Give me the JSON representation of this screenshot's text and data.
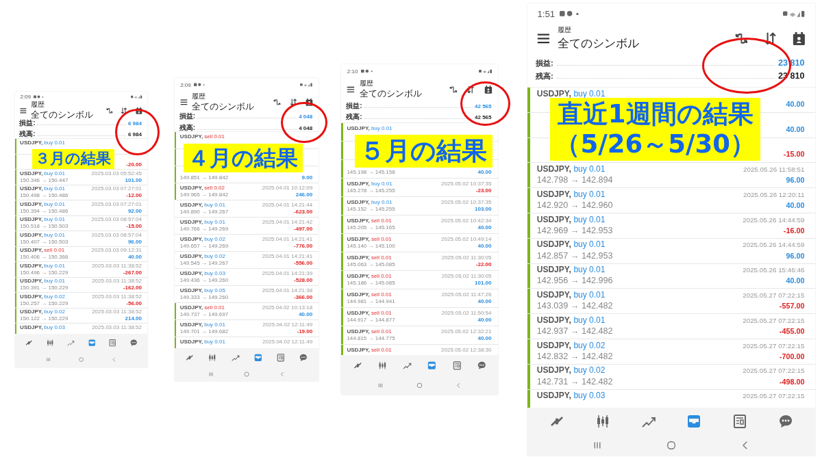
{
  "phones": [
    {
      "status_time": "2:09",
      "subtitle": "履歴",
      "title": "全てのシンボル",
      "summary": [
        {
          "label": "損益:",
          "value": "6 984",
          "kind": "profit"
        },
        {
          "label": "残高:",
          "value": "6 984",
          "kind": "balance"
        }
      ],
      "rows": [
        {
          "symbol": "USDJPY,",
          "order": "buy 0.01",
          "kind": "buy",
          "flagged": true
        },
        {
          "profit": "-20.00",
          "loss": true,
          "flagged": true
        },
        {
          "symbol": "USDJPY,",
          "order": "buy 0.01",
          "kind": "buy",
          "time": "2025.03.03 05:52:45",
          "prices": "150.346 → 150.447",
          "profit": "101.00",
          "loss": false,
          "flagged": true
        },
        {
          "symbol": "USDJPY,",
          "order": "buy 0.01",
          "kind": "buy",
          "time": "2025.03.03 07:27:01",
          "prices": "150.498 → 150.486",
          "profit": "-12.00",
          "loss": true,
          "flagged": true
        },
        {
          "symbol": "USDJPY,",
          "order": "buy 0.01",
          "kind": "buy",
          "time": "2025.03.03 07:27:01",
          "prices": "150.394 → 150.486",
          "profit": "92.00",
          "loss": false,
          "flagged": true
        },
        {
          "symbol": "USDJPY,",
          "order": "buy 0.01",
          "kind": "buy",
          "time": "2025.03.03 08:57:04",
          "prices": "150.518 → 150.503",
          "profit": "-15.00",
          "loss": true,
          "flagged": true
        },
        {
          "symbol": "USDJPY,",
          "order": "buy 0.01",
          "kind": "buy",
          "time": "2025.03.03 08:57:04",
          "prices": "150.407 → 150.503",
          "profit": "96.00",
          "loss": false,
          "flagged": true
        },
        {
          "symbol": "USDJPY,",
          "order": "sell 0.01",
          "kind": "sell",
          "time": "2025.03.03 09:12:31",
          "prices": "150.406 → 150.366",
          "profit": "40.00",
          "loss": false,
          "flagged": true
        },
        {
          "symbol": "USDJPY,",
          "order": "buy 0.01",
          "kind": "buy",
          "time": "2025.03.03 11:38:52",
          "prices": "150.496 → 150.229",
          "profit": "-267.00",
          "loss": true,
          "flagged": true
        },
        {
          "symbol": "USDJPY,",
          "order": "buy 0.01",
          "kind": "buy",
          "time": "2025.03.03 11:38:52",
          "prices": "150.391 → 150.229",
          "profit": "-162.00",
          "loss": true,
          "flagged": true
        },
        {
          "symbol": "USDJPY,",
          "order": "buy 0.02",
          "kind": "buy",
          "time": "2025.03.03 11:38:52",
          "prices": "150.257 → 150.229",
          "profit": "-56.00",
          "loss": true,
          "flagged": true
        },
        {
          "symbol": "USDJPY,",
          "order": "buy 0.02",
          "kind": "buy",
          "time": "2025.03.03 11:38:52",
          "prices": "150.122 → 150.229",
          "profit": "214.00",
          "loss": false,
          "flagged": true
        },
        {
          "symbol": "USDJPY,",
          "order": "buy 0.03",
          "kind": "buy",
          "time": "2025.03.03 11:38:52",
          "flagged": true
        }
      ],
      "nav": [
        {
          "kind": "quotes",
          "selected": false
        },
        {
          "kind": "chart",
          "selected": false
        },
        {
          "kind": "trade",
          "selected": false
        },
        {
          "kind": "history",
          "selected": true
        },
        {
          "kind": "news",
          "selected": false
        },
        {
          "kind": "chat",
          "selected": false
        }
      ],
      "caption": [
        "３月の結果"
      ]
    },
    {
      "status_time": "2:09",
      "subtitle": "履歴",
      "title": "全てのシンボル",
      "summary": [
        {
          "label": "損益:",
          "value": "4 048",
          "kind": "profit"
        },
        {
          "label": "残高:",
          "value": "4 048",
          "kind": "balance"
        }
      ],
      "rows": [
        {
          "symbol": "USDJPY,",
          "order": "sell 0.01",
          "kind": "sell",
          "flagged": true
        },
        {
          "flagged": true
        },
        {
          "prices": "149.851 → 149.842",
          "profit": "9.00",
          "loss": false,
          "flagged": true
        },
        {
          "symbol": "USDJPY,",
          "order": "sell 0.02",
          "kind": "sell",
          "time": "2025.04.01 10:12:09",
          "prices": "149.965 → 149.842",
          "profit": "246.00",
          "loss": false,
          "flagged": true
        },
        {
          "symbol": "USDJPY,",
          "order": "buy 0.01",
          "kind": "buy",
          "time": "2025.04.01 14:21:44",
          "prices": "149.890 → 149.267",
          "profit": "-623.00",
          "loss": true,
          "flagged": false
        },
        {
          "symbol": "USDJPY,",
          "order": "buy 0.01",
          "kind": "buy",
          "time": "2025.04.01 14:21:42",
          "prices": "149.766 → 149.269",
          "profit": "-497.00",
          "loss": true,
          "flagged": false
        },
        {
          "symbol": "USDJPY,",
          "order": "buy 0.02",
          "kind": "buy",
          "time": "2025.04.01 14:21:41",
          "prices": "149.657 → 149.269",
          "profit": "-776.00",
          "loss": true,
          "flagged": false
        },
        {
          "symbol": "USDJPY,",
          "order": "buy 0.02",
          "kind": "buy",
          "time": "2025.04.01 14:21:41",
          "prices": "149.545 → 149.267",
          "profit": "-556.00",
          "loss": true,
          "flagged": false
        },
        {
          "symbol": "USDJPY,",
          "order": "buy 0.03",
          "kind": "buy",
          "time": "2025.04.01 14:21:39",
          "prices": "149.436 → 149.260",
          "profit": "-528.00",
          "loss": true,
          "flagged": false
        },
        {
          "symbol": "USDJPY,",
          "order": "buy 0.05",
          "kind": "buy",
          "time": "2025.04.01 14:21:38",
          "prices": "149.333 → 149.260",
          "profit": "-366.00",
          "loss": true,
          "flagged": false
        },
        {
          "symbol": "USDJPY,",
          "order": "sell 0.01",
          "kind": "sell",
          "time": "2025.04.02 10:13:18",
          "prices": "149.737 → 149.697",
          "profit": "40.00",
          "loss": false,
          "flagged": true
        },
        {
          "symbol": "USDJPY,",
          "order": "buy 0.01",
          "kind": "buy",
          "time": "2025.04.02 12:11:49",
          "prices": "149.701 → 149.682",
          "profit": "-19.00",
          "loss": true,
          "flagged": true
        },
        {
          "symbol": "USDJPY,",
          "order": "buy 0.01",
          "kind": "buy",
          "time": "2025.04.02 12:11:49",
          "flagged": true
        }
      ],
      "nav": [
        {
          "kind": "quotes",
          "selected": false
        },
        {
          "kind": "chart",
          "selected": false
        },
        {
          "kind": "trade",
          "selected": false
        },
        {
          "kind": "history",
          "selected": true
        },
        {
          "kind": "news",
          "selected": false
        },
        {
          "kind": "chat",
          "selected": false
        }
      ],
      "caption": [
        "４月の結果"
      ]
    },
    {
      "status_time": "2:10",
      "subtitle": "履歴",
      "title": "全てのシンボル",
      "summary": [
        {
          "label": "損益:",
          "value": "42 565",
          "kind": "profit"
        },
        {
          "label": "残高:",
          "value": "42 565",
          "kind": "balance"
        }
      ],
      "rows": [
        {
          "symbol": "USDJPY,",
          "order": "buy 0.01",
          "kind": "buy",
          "flagged": true
        },
        {
          "flagged": true
        },
        {
          "prices": "145.198 → 145.158",
          "profit": "40.00",
          "loss": false,
          "flagged": true
        },
        {
          "symbol": "USDJPY,",
          "order": "buy 0.01",
          "kind": "buy",
          "time": "2025.05.02 10:37:35",
          "prices": "145.278 → 145.255",
          "profit": "-23.00",
          "loss": true,
          "flagged": true
        },
        {
          "symbol": "USDJPY,",
          "order": "buy 0.01",
          "kind": "buy",
          "time": "2025.05.02 10:37:35",
          "prices": "145.152 → 145.255",
          "profit": "103.00",
          "loss": false,
          "flagged": true
        },
        {
          "symbol": "USDJPY,",
          "order": "sell 0.01",
          "kind": "sell",
          "time": "2025.05.02 10:42:34",
          "prices": "145.205 → 145.165",
          "profit": "40.00",
          "loss": false,
          "flagged": true
        },
        {
          "symbol": "USDJPY,",
          "order": "sell 0.01",
          "kind": "sell",
          "time": "2025.05.02 10:49:14",
          "prices": "145.140 → 145.100",
          "profit": "40.00",
          "loss": false,
          "flagged": true
        },
        {
          "symbol": "USDJPY,",
          "order": "sell 0.01",
          "kind": "sell",
          "time": "2025.05.02 11:30:05",
          "prices": "145.063 → 145.085",
          "profit": "-22.00",
          "loss": true,
          "flagged": true
        },
        {
          "symbol": "USDJPY,",
          "order": "sell 0.01",
          "kind": "sell",
          "time": "2025.05.02 11:30:05",
          "prices": "145.186 → 145.085",
          "profit": "101.00",
          "loss": false,
          "flagged": true
        },
        {
          "symbol": "USDJPY,",
          "order": "sell 0.01",
          "kind": "sell",
          "time": "2025.05.02 11:47:26",
          "prices": "144.981 → 144.941",
          "profit": "40.00",
          "loss": false,
          "flagged": true
        },
        {
          "symbol": "USDJPY,",
          "order": "sell 0.01",
          "kind": "sell",
          "time": "2025.05.02 11:50:54",
          "prices": "144.917 → 144.877",
          "profit": "40.00",
          "loss": false,
          "flagged": true
        },
        {
          "symbol": "USDJPY,",
          "order": "sell 0.01",
          "kind": "sell",
          "time": "2025.05.02 12:32:21",
          "prices": "144.815 → 144.775",
          "profit": "40.00",
          "loss": false,
          "flagged": true
        },
        {
          "symbol": "USDJPY,",
          "order": "sell 0.01",
          "kind": "sell",
          "time": "2025.05.02 12:38:30",
          "flagged": true
        }
      ],
      "nav": [
        {
          "kind": "quotes",
          "selected": false
        },
        {
          "kind": "chart",
          "selected": false
        },
        {
          "kind": "trade",
          "selected": false
        },
        {
          "kind": "history",
          "selected": true
        },
        {
          "kind": "news",
          "selected": false
        },
        {
          "kind": "chat",
          "selected": false
        }
      ],
      "caption": [
        "５月の結果"
      ]
    },
    {
      "status_time": "1:51",
      "subtitle": "履歴",
      "title": "全てのシンボル",
      "summary": [
        {
          "label": "損益:",
          "value": "23 810",
          "kind": "profit"
        },
        {
          "label": "残高:",
          "value": "23 810",
          "kind": "balance"
        }
      ],
      "rows": [
        {
          "symbol": "USDJPY,",
          "order": "buy 0.01",
          "kind": "buy",
          "profit": "40.00",
          "loss": false,
          "flagged": true
        },
        {
          "profit": "40.00",
          "loss": false,
          "flagged": true
        },
        {
          "profit": "-15.00",
          "loss": true,
          "flagged": true
        },
        {
          "symbol": "USDJPY,",
          "order": "buy 0.01",
          "kind": "buy",
          "time": "2025.05.26 11:58:51",
          "prices": "142.798 → 142.894",
          "profit": "96.00",
          "loss": false,
          "flagged": true
        },
        {
          "symbol": "USDJPY,",
          "order": "buy 0.01",
          "kind": "buy",
          "time": "2025.05.26 12:20:11",
          "prices": "142.920 → 142.960",
          "profit": "40.00",
          "loss": false,
          "flagged": true
        },
        {
          "symbol": "USDJPY,",
          "order": "buy 0.01",
          "kind": "buy",
          "time": "2025.05.26 14:44:59",
          "prices": "142.969 → 142.953",
          "profit": "-16.00",
          "loss": true,
          "flagged": true
        },
        {
          "symbol": "USDJPY,",
          "order": "buy 0.01",
          "kind": "buy",
          "time": "2025.05.26 14:44:59",
          "prices": "142.857 → 142.953",
          "profit": "96.00",
          "loss": false,
          "flagged": true
        },
        {
          "symbol": "USDJPY,",
          "order": "buy 0.01",
          "kind": "buy",
          "time": "2025.05.26 15:46:46",
          "prices": "142.956 → 142.996",
          "profit": "40.00",
          "loss": false,
          "flagged": true
        },
        {
          "symbol": "USDJPY,",
          "order": "buy 0.01",
          "kind": "buy",
          "time": "2025.05.27 07:22:15",
          "prices": "143.039 → 142.482",
          "profit": "-557.00",
          "loss": true,
          "flagged": true
        },
        {
          "symbol": "USDJPY,",
          "order": "buy 0.01",
          "kind": "buy",
          "time": "2025.05.27 07:22:15",
          "prices": "142.937 → 142.482",
          "profit": "-455.00",
          "loss": true,
          "flagged": true
        },
        {
          "symbol": "USDJPY,",
          "order": "buy 0.02",
          "kind": "buy",
          "time": "2025.05.27 07:22:15",
          "prices": "142.832 → 142.482",
          "profit": "-700.00",
          "loss": true,
          "flagged": true
        },
        {
          "symbol": "USDJPY,",
          "order": "buy 0.02",
          "kind": "buy",
          "time": "2025.05.27 07:22:15",
          "prices": "142.731 → 142.482",
          "profit": "-498.00",
          "loss": true,
          "flagged": true
        },
        {
          "symbol": "USDJPY,",
          "order": "buy 0.03",
          "kind": "buy",
          "time": "2025.05.27 07:22:15",
          "flagged": true
        }
      ],
      "nav": [
        {
          "kind": "quotes",
          "selected": false
        },
        {
          "kind": "chart",
          "selected": false
        },
        {
          "kind": "trade",
          "selected": false
        },
        {
          "kind": "history",
          "selected": true
        },
        {
          "kind": "news",
          "selected": false
        },
        {
          "kind": "chat",
          "selected": false
        }
      ],
      "caption": [
        "直近1週間の結果",
        "（5/26～5/30）"
      ]
    }
  ]
}
